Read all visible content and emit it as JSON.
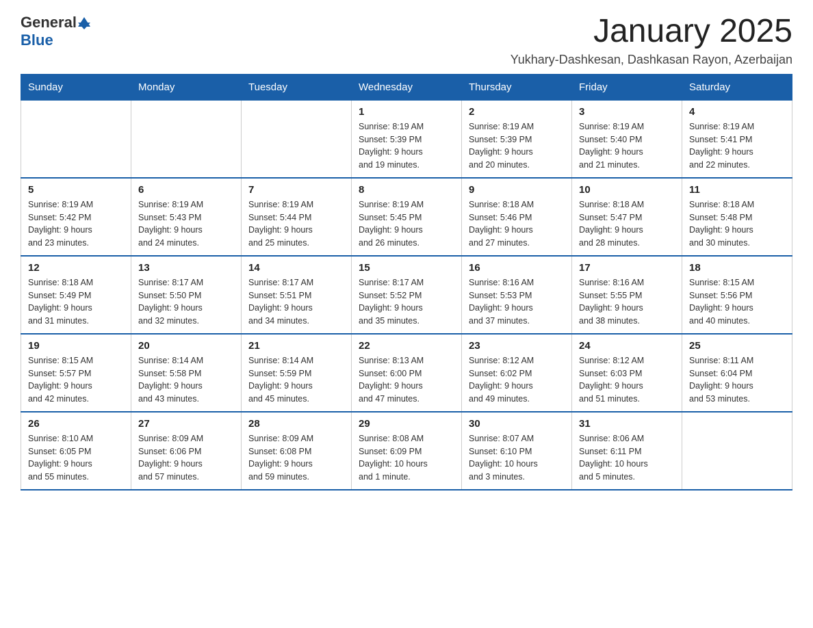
{
  "header": {
    "logo_general": "General",
    "logo_blue": "Blue",
    "month_year": "January 2025",
    "location": "Yukhary-Dashkesan, Dashkasan Rayon, Azerbaijan"
  },
  "weekdays": [
    "Sunday",
    "Monday",
    "Tuesday",
    "Wednesday",
    "Thursday",
    "Friday",
    "Saturday"
  ],
  "weeks": [
    [
      {
        "day": "",
        "info": ""
      },
      {
        "day": "",
        "info": ""
      },
      {
        "day": "",
        "info": ""
      },
      {
        "day": "1",
        "info": "Sunrise: 8:19 AM\nSunset: 5:39 PM\nDaylight: 9 hours\nand 19 minutes."
      },
      {
        "day": "2",
        "info": "Sunrise: 8:19 AM\nSunset: 5:39 PM\nDaylight: 9 hours\nand 20 minutes."
      },
      {
        "day": "3",
        "info": "Sunrise: 8:19 AM\nSunset: 5:40 PM\nDaylight: 9 hours\nand 21 minutes."
      },
      {
        "day": "4",
        "info": "Sunrise: 8:19 AM\nSunset: 5:41 PM\nDaylight: 9 hours\nand 22 minutes."
      }
    ],
    [
      {
        "day": "5",
        "info": "Sunrise: 8:19 AM\nSunset: 5:42 PM\nDaylight: 9 hours\nand 23 minutes."
      },
      {
        "day": "6",
        "info": "Sunrise: 8:19 AM\nSunset: 5:43 PM\nDaylight: 9 hours\nand 24 minutes."
      },
      {
        "day": "7",
        "info": "Sunrise: 8:19 AM\nSunset: 5:44 PM\nDaylight: 9 hours\nand 25 minutes."
      },
      {
        "day": "8",
        "info": "Sunrise: 8:19 AM\nSunset: 5:45 PM\nDaylight: 9 hours\nand 26 minutes."
      },
      {
        "day": "9",
        "info": "Sunrise: 8:18 AM\nSunset: 5:46 PM\nDaylight: 9 hours\nand 27 minutes."
      },
      {
        "day": "10",
        "info": "Sunrise: 8:18 AM\nSunset: 5:47 PM\nDaylight: 9 hours\nand 28 minutes."
      },
      {
        "day": "11",
        "info": "Sunrise: 8:18 AM\nSunset: 5:48 PM\nDaylight: 9 hours\nand 30 minutes."
      }
    ],
    [
      {
        "day": "12",
        "info": "Sunrise: 8:18 AM\nSunset: 5:49 PM\nDaylight: 9 hours\nand 31 minutes."
      },
      {
        "day": "13",
        "info": "Sunrise: 8:17 AM\nSunset: 5:50 PM\nDaylight: 9 hours\nand 32 minutes."
      },
      {
        "day": "14",
        "info": "Sunrise: 8:17 AM\nSunset: 5:51 PM\nDaylight: 9 hours\nand 34 minutes."
      },
      {
        "day": "15",
        "info": "Sunrise: 8:17 AM\nSunset: 5:52 PM\nDaylight: 9 hours\nand 35 minutes."
      },
      {
        "day": "16",
        "info": "Sunrise: 8:16 AM\nSunset: 5:53 PM\nDaylight: 9 hours\nand 37 minutes."
      },
      {
        "day": "17",
        "info": "Sunrise: 8:16 AM\nSunset: 5:55 PM\nDaylight: 9 hours\nand 38 minutes."
      },
      {
        "day": "18",
        "info": "Sunrise: 8:15 AM\nSunset: 5:56 PM\nDaylight: 9 hours\nand 40 minutes."
      }
    ],
    [
      {
        "day": "19",
        "info": "Sunrise: 8:15 AM\nSunset: 5:57 PM\nDaylight: 9 hours\nand 42 minutes."
      },
      {
        "day": "20",
        "info": "Sunrise: 8:14 AM\nSunset: 5:58 PM\nDaylight: 9 hours\nand 43 minutes."
      },
      {
        "day": "21",
        "info": "Sunrise: 8:14 AM\nSunset: 5:59 PM\nDaylight: 9 hours\nand 45 minutes."
      },
      {
        "day": "22",
        "info": "Sunrise: 8:13 AM\nSunset: 6:00 PM\nDaylight: 9 hours\nand 47 minutes."
      },
      {
        "day": "23",
        "info": "Sunrise: 8:12 AM\nSunset: 6:02 PM\nDaylight: 9 hours\nand 49 minutes."
      },
      {
        "day": "24",
        "info": "Sunrise: 8:12 AM\nSunset: 6:03 PM\nDaylight: 9 hours\nand 51 minutes."
      },
      {
        "day": "25",
        "info": "Sunrise: 8:11 AM\nSunset: 6:04 PM\nDaylight: 9 hours\nand 53 minutes."
      }
    ],
    [
      {
        "day": "26",
        "info": "Sunrise: 8:10 AM\nSunset: 6:05 PM\nDaylight: 9 hours\nand 55 minutes."
      },
      {
        "day": "27",
        "info": "Sunrise: 8:09 AM\nSunset: 6:06 PM\nDaylight: 9 hours\nand 57 minutes."
      },
      {
        "day": "28",
        "info": "Sunrise: 8:09 AM\nSunset: 6:08 PM\nDaylight: 9 hours\nand 59 minutes."
      },
      {
        "day": "29",
        "info": "Sunrise: 8:08 AM\nSunset: 6:09 PM\nDaylight: 10 hours\nand 1 minute."
      },
      {
        "day": "30",
        "info": "Sunrise: 8:07 AM\nSunset: 6:10 PM\nDaylight: 10 hours\nand 3 minutes."
      },
      {
        "day": "31",
        "info": "Sunrise: 8:06 AM\nSunset: 6:11 PM\nDaylight: 10 hours\nand 5 minutes."
      },
      {
        "day": "",
        "info": ""
      }
    ]
  ]
}
